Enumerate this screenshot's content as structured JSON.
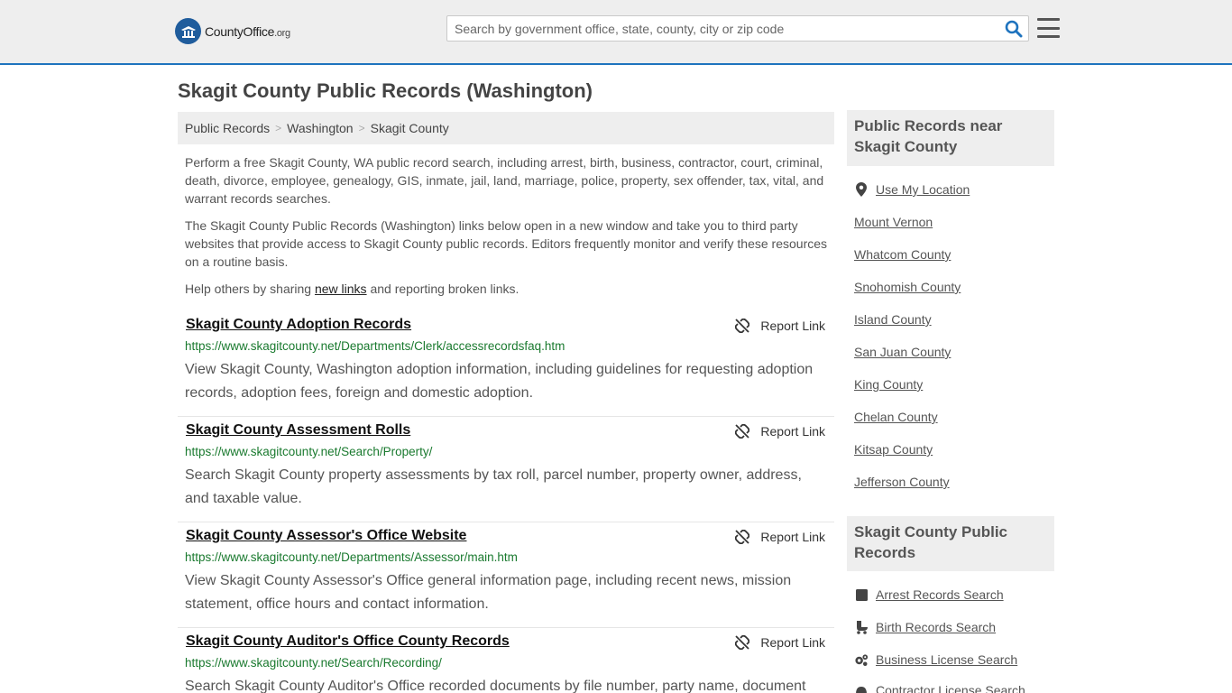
{
  "header": {
    "logo_main": "CountyOffice",
    "logo_suffix": ".org",
    "search_placeholder": "Search by government office, state, county, city or zip code"
  },
  "page": {
    "title": "Skagit County Public Records (Washington)"
  },
  "breadcrumb": [
    "Public Records",
    "Washington",
    "Skagit County"
  ],
  "intro": {
    "p1": "Perform a free Skagit County, WA public record search, including arrest, birth, business, contractor, court, criminal, death, divorce, employee, genealogy, GIS, inmate, jail, land, marriage, police, property, sex offender, tax, vital, and warrant records searches.",
    "p2": "The Skagit County Public Records (Washington) links below open in a new window and take you to third party websites that provide access to Skagit County public records. Editors frequently monitor and verify these resources on a routine basis.",
    "p3_before": "Help others by sharing ",
    "p3_link": "new links",
    "p3_after": " and reporting broken links."
  },
  "report_label": "Report Link",
  "records": [
    {
      "title": "Skagit County Adoption Records",
      "url": "https://www.skagitcounty.net/Departments/Clerk/accessrecordsfaq.htm",
      "description": "View Skagit County, Washington adoption information, including guidelines for requesting adoption records, adoption fees, foreign and domestic adoption."
    },
    {
      "title": "Skagit County Assessment Rolls",
      "url": "https://www.skagitcounty.net/Search/Property/",
      "description": "Search Skagit County property assessments by tax roll, parcel number, property owner, address, and taxable value."
    },
    {
      "title": "Skagit County Assessor's Office Website",
      "url": "https://www.skagitcounty.net/Departments/Assessor/main.htm",
      "description": "View Skagit County Assessor's Office general information page, including recent news, mission statement, office hours and contact information."
    },
    {
      "title": "Skagit County Auditor's Office County Records",
      "url": "https://www.skagitcounty.net/Search/Recording/",
      "description": "Search Skagit County Auditor's Office recorded documents by file number, party name, document"
    }
  ],
  "sidebar": {
    "nearby_heading": "Public Records near Skagit County",
    "use_location": "Use My Location",
    "nearby": [
      "Mount Vernon",
      "Whatcom County",
      "Snohomish County",
      "Island County",
      "San Juan County",
      "King County",
      "Chelan County",
      "Kitsap County",
      "Jefferson County"
    ],
    "county_heading": "Skagit County Public Records",
    "county_links": [
      {
        "label": "Arrest Records Search",
        "icon": "square-icon"
      },
      {
        "label": "Birth Records Search",
        "icon": "baby-stroller-icon"
      },
      {
        "label": "Business License Search",
        "icon": "gears-icon"
      },
      {
        "label": "Contractor License Search",
        "icon": "hard-hat-icon"
      }
    ]
  },
  "colors": {
    "accent": "#1e73be",
    "url_green": "#1a7a2f",
    "header_bg": "#eeeeee"
  }
}
